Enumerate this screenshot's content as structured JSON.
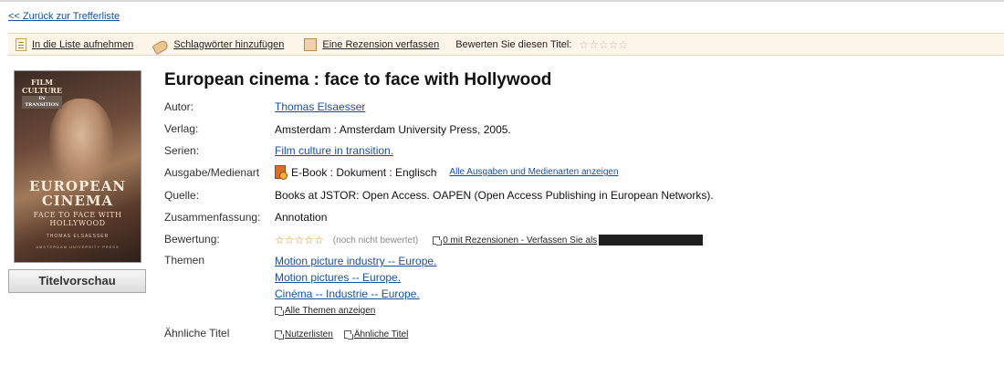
{
  "nav": {
    "back_label": "<< Zurück zur Trefferliste"
  },
  "toolbar": {
    "add_list": "In die Liste aufnehmen",
    "add_tags": "Schlagwörter hinzufügen",
    "write_review": "Eine Rezension verfassen",
    "rate_label": "Bewerten Sie diesen Titel:",
    "stars": "☆☆☆☆☆"
  },
  "cover": {
    "series_line1": "FILM",
    "series_line2": "CULTURE",
    "series_band": "IN TRANSITION",
    "title_line1": "EUROPEAN",
    "title_line2": "CINEMA",
    "subtitle_line1": "FACE TO FACE WITH",
    "subtitle_line2": "HOLLYWOOD",
    "author": "THOMAS ELSAESSER",
    "publisher": "AMSTERDAM UNIVERSITY PRESS"
  },
  "preview_button": "Titelvorschau",
  "book": {
    "title": "European cinema : face to face with Hollywood",
    "labels": {
      "author": "Autor:",
      "publisher": "Verlag:",
      "series": "Serien:",
      "edition": "Ausgabe/Medienart",
      "source": "Quelle:",
      "summary": "Zusammenfassung:",
      "rating": "Bewertung:",
      "topics": "Themen",
      "similar": "Ähnliche Titel"
    },
    "author": "Thomas Elsaesser",
    "publisher": "Amsterdam : Amsterdam University Press, 2005.",
    "series": "Film culture in transition.",
    "edition": "E-Book : Dokument : Englisch",
    "edition_link": "Alle Ausgaben und Medienarten anzeigen",
    "source": "Books at JSTOR: Open Access. OAPEN (Open Access Publishing in European Networks).",
    "summary": "Annotation",
    "rating_stars": "☆☆☆☆☆",
    "rating_status": "(noch nicht bewertet)",
    "reviews_link": "0 mit Rezensionen - Verfassen Sie als",
    "topics": [
      "Motion picture industry -- Europe.",
      "Motion pictures -- Europe.",
      "Cinéma -- Industrie -- Europe."
    ],
    "all_topics": "Alle Themen anzeigen",
    "user_lists": "Nutzerlisten",
    "similar_titles": "Ähnliche Titel"
  }
}
